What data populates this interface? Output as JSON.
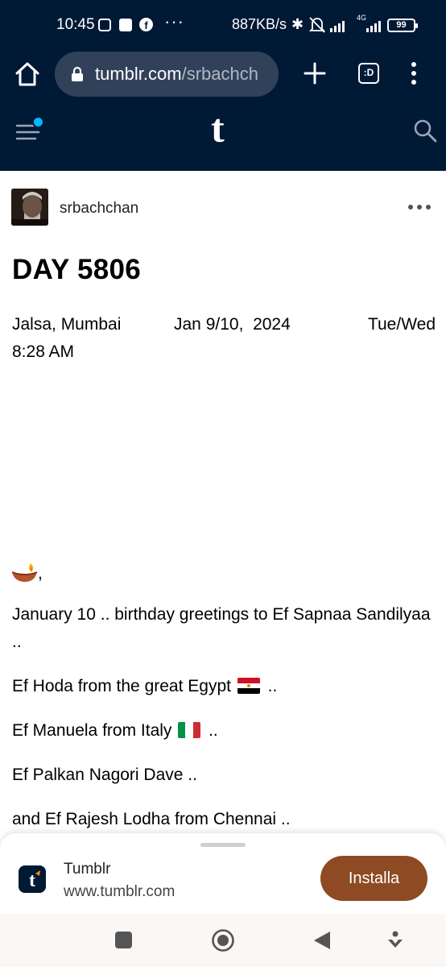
{
  "status_bar": {
    "time": "10:45",
    "network_speed": "887KB/s",
    "network_type": "4G",
    "battery": "99"
  },
  "browser": {
    "url_domain": "tumblr.com",
    "url_path": "/srbachch",
    "tabs_label": ":D"
  },
  "tumblr": {
    "logo": "t",
    "icons": {
      "menu": "menu-icon",
      "search": "search-icon"
    }
  },
  "post": {
    "author": "srbachchan",
    "title": "DAY 5806",
    "location": "Jalsa, Mumbai",
    "date": "Jan 9/10,  2024",
    "days": "Tue/Wed",
    "time": "8:28 AM",
    "after_diya": ",",
    "paragraphs": [
      "January 10 .. birthday greetings to Ef Sapnaa Sandilyaa ..",
      "Ef Hoda from the great Egypt",
      "Ef Manuela from Italy",
      "Ef Palkan Nagori Dave ..",
      "and Ef Rajesh Lodha from Chennai .."
    ],
    "trail": " .."
  },
  "install_banner": {
    "app_name": "Tumblr",
    "app_url": "www.tumblr.com",
    "button_label": "Installa"
  },
  "colors": {
    "header_bg": "#001935",
    "url_bar_bg": "#31415a",
    "install_button": "#8e4a23",
    "notification_dot": "#00b8ff"
  }
}
